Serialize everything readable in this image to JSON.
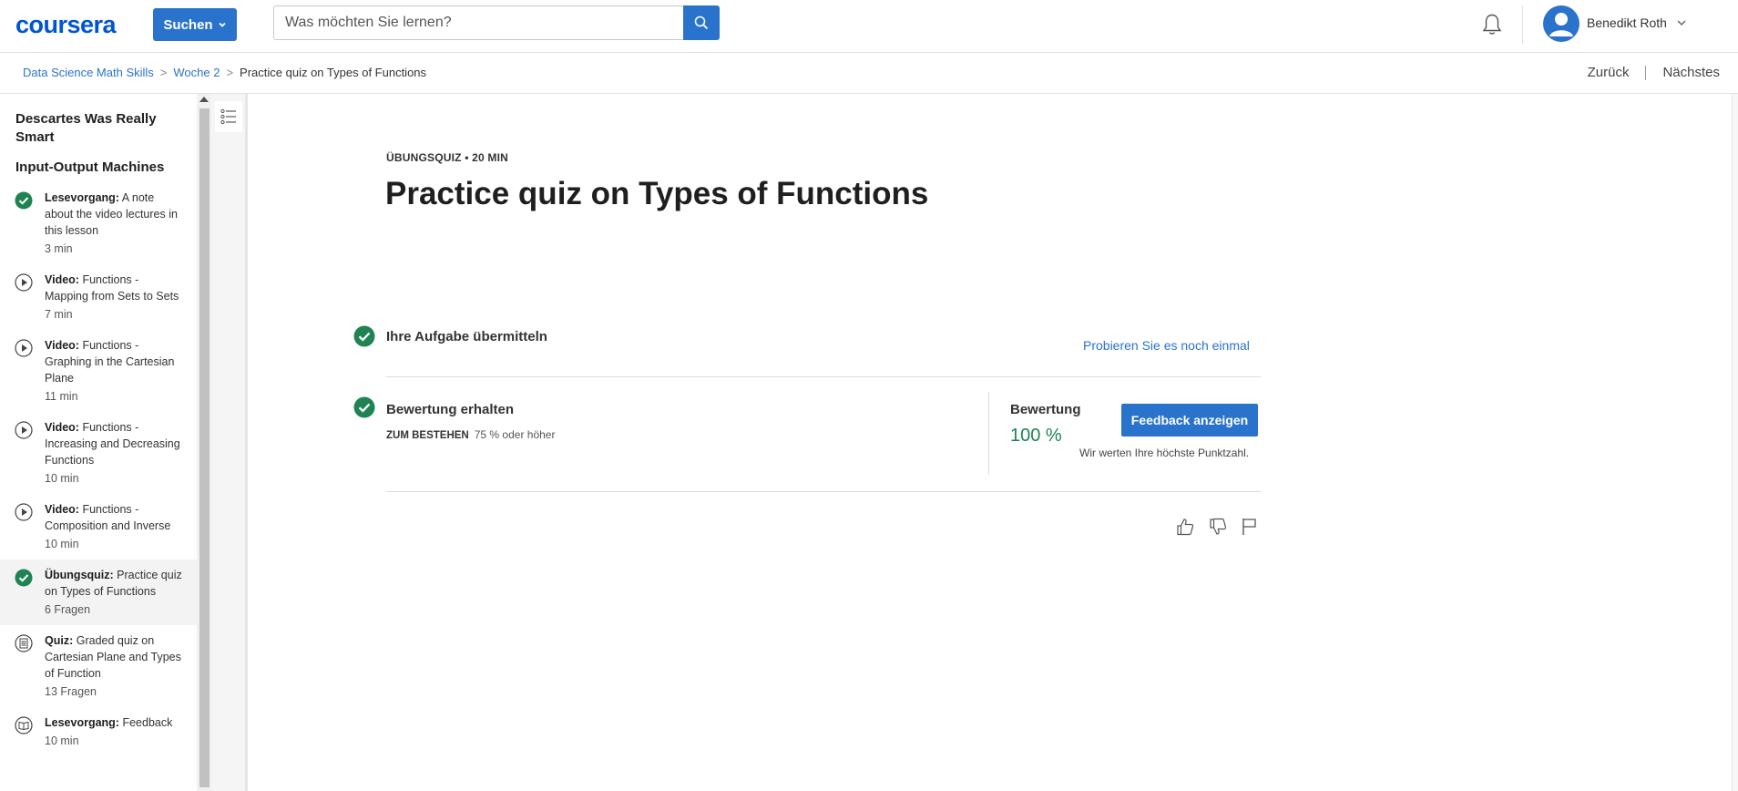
{
  "header": {
    "logo": "coursera",
    "explore_label": "Suchen",
    "search_placeholder": "Was möchten Sie lernen?",
    "user_name": "Benedikt Roth"
  },
  "breadcrumb": {
    "items": [
      "Data Science Math Skills",
      "Woche 2"
    ],
    "current": "Practice quiz on Types of Functions",
    "separator": ">"
  },
  "nav": {
    "back": "Zurück",
    "next": "Nächstes"
  },
  "sidebar": {
    "module_title": "Descartes Was Really Smart",
    "lesson_title": "Input-Output Machines",
    "items": [
      {
        "type": "Lesevorgang:",
        "title": "A note about the video lectures in this lesson",
        "meta": "3 min",
        "icon": "completed-check-icon",
        "active": false
      },
      {
        "type": "Video:",
        "title": "Functions - Mapping from Sets to Sets",
        "meta": "7 min",
        "icon": "video-play-icon",
        "active": false
      },
      {
        "type": "Video:",
        "title": "Functions - Graphing in the Cartesian Plane",
        "meta": "11 min",
        "icon": "video-play-icon",
        "active": false
      },
      {
        "type": "Video:",
        "title": "Functions - Increasing and Decreasing Functions",
        "meta": "10 min",
        "icon": "video-play-icon",
        "active": false
      },
      {
        "type": "Video:",
        "title": "Functions - Composition and Inverse",
        "meta": "10 min",
        "icon": "video-play-icon",
        "active": false
      },
      {
        "type": "Übungsquiz:",
        "title": "Practice quiz on Types of Functions",
        "meta": "6 Fragen",
        "icon": "completed-check-icon",
        "active": true
      },
      {
        "type": "Quiz:",
        "title": "Graded quiz on Cartesian Plane and Types of Function",
        "meta": "13 Fragen",
        "icon": "quiz-icon",
        "active": false
      },
      {
        "type": "Lesevorgang:",
        "title": "Feedback",
        "meta": "10 min",
        "icon": "reading-book-icon",
        "active": false
      }
    ]
  },
  "main": {
    "eyebrow": "ÜBUNGSQUIZ • 20 MIN",
    "title": "Practice quiz on Types of Functions",
    "submit_row": {
      "label": "Ihre Aufgabe übermitteln",
      "retry": "Probieren Sie es noch einmal"
    },
    "grade_row": {
      "label": "Bewertung erhalten",
      "pass_label": "ZUM BESTEHEN",
      "pass_value": "75 % oder höher",
      "grade_label": "Bewertung",
      "grade_value": "100 %",
      "feedback_button": "Feedback anzeigen",
      "note": "Wir werten Ihre höchste Punktzahl."
    }
  },
  "colors": {
    "primary": "#2a73cc",
    "success": "#1f8354",
    "logo": "#0056d2"
  }
}
